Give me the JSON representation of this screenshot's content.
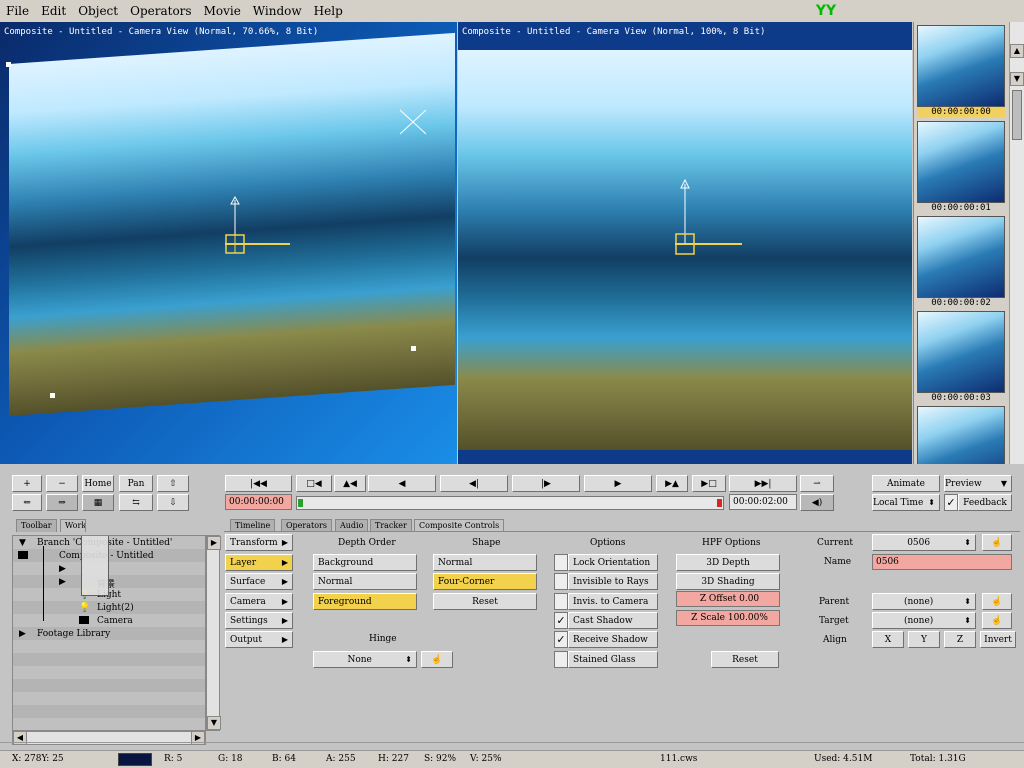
{
  "menu": [
    "File",
    "Edit",
    "Object",
    "Operators",
    "Movie",
    "Window",
    "Help"
  ],
  "logo": "YY",
  "viewer_left": {
    "title": "Composite - Untitled - Camera View (Normal, 70.66%, 8 Bit)"
  },
  "viewer_right": {
    "title": "Composite - Untitled - Camera View (Normal, 100%, 8 Bit)"
  },
  "filmstrip": {
    "timecodes": [
      "00:00:00:00",
      "00:00:00:01",
      "00:00:00:02",
      "00:00:00:03"
    ],
    "selected_index": 0
  },
  "toolbar": {
    "plus": "+",
    "minus": "−",
    "home": "Home",
    "pan": "Pan"
  },
  "timeline": {
    "start_time": "00:00:00:00",
    "end_time": "00:00:02:00"
  },
  "top_right": {
    "animate": "Animate",
    "preview": "Preview",
    "local_time": "Local Time",
    "feedback": "Feedback"
  },
  "left_tabs": [
    "Toolbar",
    "Workspace"
  ],
  "tree": [
    {
      "label": "Branch 'Composite - Untitled'"
    },
    {
      "label": "Composite - Untitled"
    },
    {
      "label": "背景"
    },
    {
      "label": "Light"
    },
    {
      "label": "Light(2)"
    },
    {
      "label": "Camera"
    },
    {
      "label": "Footage Library"
    }
  ],
  "tabs": [
    "Timeline",
    "Operators",
    "Audio",
    "Tracker",
    "Composite Controls"
  ],
  "categories": [
    "Transform",
    "Layer",
    "Surface",
    "Camera",
    "Settings",
    "Output"
  ],
  "depth_order": {
    "header": "Depth Order",
    "items": [
      "Background",
      "Normal",
      "Foreground"
    ]
  },
  "shape": {
    "header": "Shape",
    "items": [
      "Normal",
      "Four-Corner"
    ],
    "reset": "Reset"
  },
  "options": {
    "header": "Options",
    "items": [
      "Lock Orientation",
      "Invisible to Rays",
      "Invis. to Camera",
      "Cast Shadow",
      "Receive Shadow",
      "Stained Glass"
    ],
    "reset": "Reset"
  },
  "hpf": {
    "header": "HPF Options",
    "depth": "3D Depth",
    "shading": "3D Shading",
    "zoffset": "Z Offset 0.00",
    "zscale": "Z Scale 100.00%"
  },
  "hinge": {
    "header": "Hinge",
    "value": "None"
  },
  "current": {
    "label": "Current",
    "value": "0506",
    "name_label": "Name",
    "name_value": "0506"
  },
  "parent": {
    "label": "Parent",
    "value": "(none)"
  },
  "target": {
    "label": "Target",
    "value": "(none)"
  },
  "align": {
    "label": "Align",
    "x": "X",
    "y": "Y",
    "z": "Z",
    "invert": "Invert"
  },
  "status": {
    "xy": "X: 278Y: 25",
    "r": "R: 5",
    "g": "G: 18",
    "b": "B: 64",
    "a": "A: 255",
    "h": "H: 227",
    "s": "S: 92%",
    "v": "V: 25%",
    "file": "111.cws",
    "used": "Used: 4.51M",
    "total": "Total: 1.31G"
  },
  "colors": {
    "accent_yellow": "#f2d14d",
    "accent_pink": "#f2a8a0",
    "panel": "#c4c4c4"
  }
}
